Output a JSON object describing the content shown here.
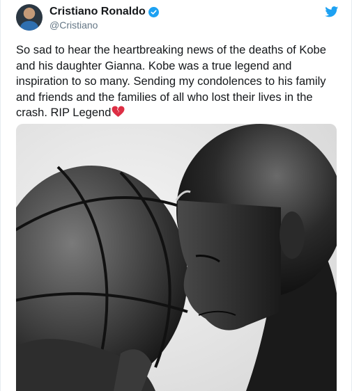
{
  "tweet": {
    "author": {
      "display_name": "Cristiano Ronaldo",
      "handle": "@Cristiano",
      "verified": true,
      "avatar_icon": "profile-photo"
    },
    "text": "So sad to hear the heartbreaking news of the deaths of Kobe and his daughter Gianna. Kobe was a true legend and inspiration to so many. Sending my condolences to his family and friends and the families of all who lost their lives in the crash. RIP Legend",
    "emoji_icon": "broken-heart-icon",
    "brand_icon": "twitter-bird-icon",
    "media_icon": "black-and-white-photo-man-holding-basketball",
    "colors": {
      "brand": "#1da1f2",
      "handle_gray": "#657786",
      "text": "#14171a",
      "heart_red": "#dd2e44"
    }
  }
}
